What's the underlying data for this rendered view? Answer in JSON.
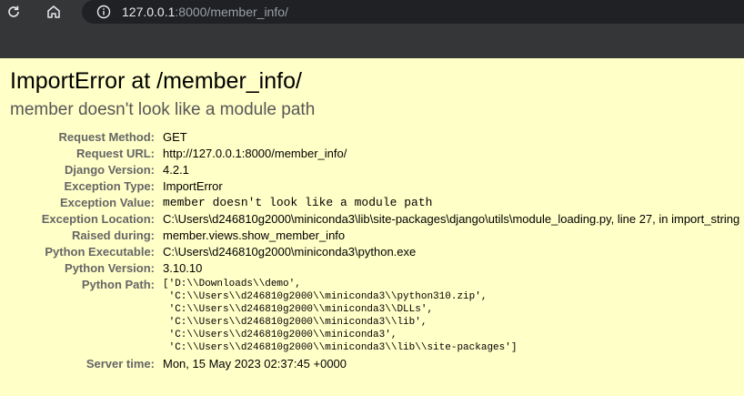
{
  "browser": {
    "url_host": "127.0.0.1",
    "url_rest": ":8000/member_info/"
  },
  "error": {
    "title": "ImportError at /member_info/",
    "message": "member doesn't look like a module path"
  },
  "meta": [
    {
      "label": "Request Method:",
      "value": "GET"
    },
    {
      "label": "Request URL:",
      "value": "http://127.0.0.1:8000/member_info/"
    },
    {
      "label": "Django Version:",
      "value": "4.2.1"
    },
    {
      "label": "Exception Type:",
      "value": "ImportError"
    },
    {
      "label": "Exception Value:",
      "value": "member doesn't look like a module path"
    },
    {
      "label": "Exception Location:",
      "value": "C:\\Users\\d246810g2000\\miniconda3\\lib\\site-packages\\django\\utils\\module_loading.py, line 27, in import_string"
    },
    {
      "label": "Raised during:",
      "value": "member.views.show_member_info"
    },
    {
      "label": "Python Executable:",
      "value": "C:\\Users\\d246810g2000\\miniconda3\\python.exe"
    },
    {
      "label": "Python Version:",
      "value": "3.10.10"
    },
    {
      "label": "Python Path:",
      "value": "['D:\\\\Downloads\\\\demo',\n 'C:\\\\Users\\\\d246810g2000\\\\miniconda3\\\\python310.zip',\n 'C:\\\\Users\\\\d246810g2000\\\\miniconda3\\\\DLLs',\n 'C:\\\\Users\\\\d246810g2000\\\\miniconda3\\\\lib',\n 'C:\\\\Users\\\\d246810g2000\\\\miniconda3',\n 'C:\\\\Users\\\\d246810g2000\\\\miniconda3\\\\lib\\\\site-packages']"
    },
    {
      "label": "Server time:",
      "value": "Mon, 15 May 2023 02:37:45 +0000"
    }
  ],
  "colors": {
    "background": "#ffffc8",
    "browser_chrome": "#343638",
    "address_bar": "#202124"
  },
  "icons": {
    "reload": "reload-icon",
    "home": "home-icon",
    "info": "info-icon"
  }
}
